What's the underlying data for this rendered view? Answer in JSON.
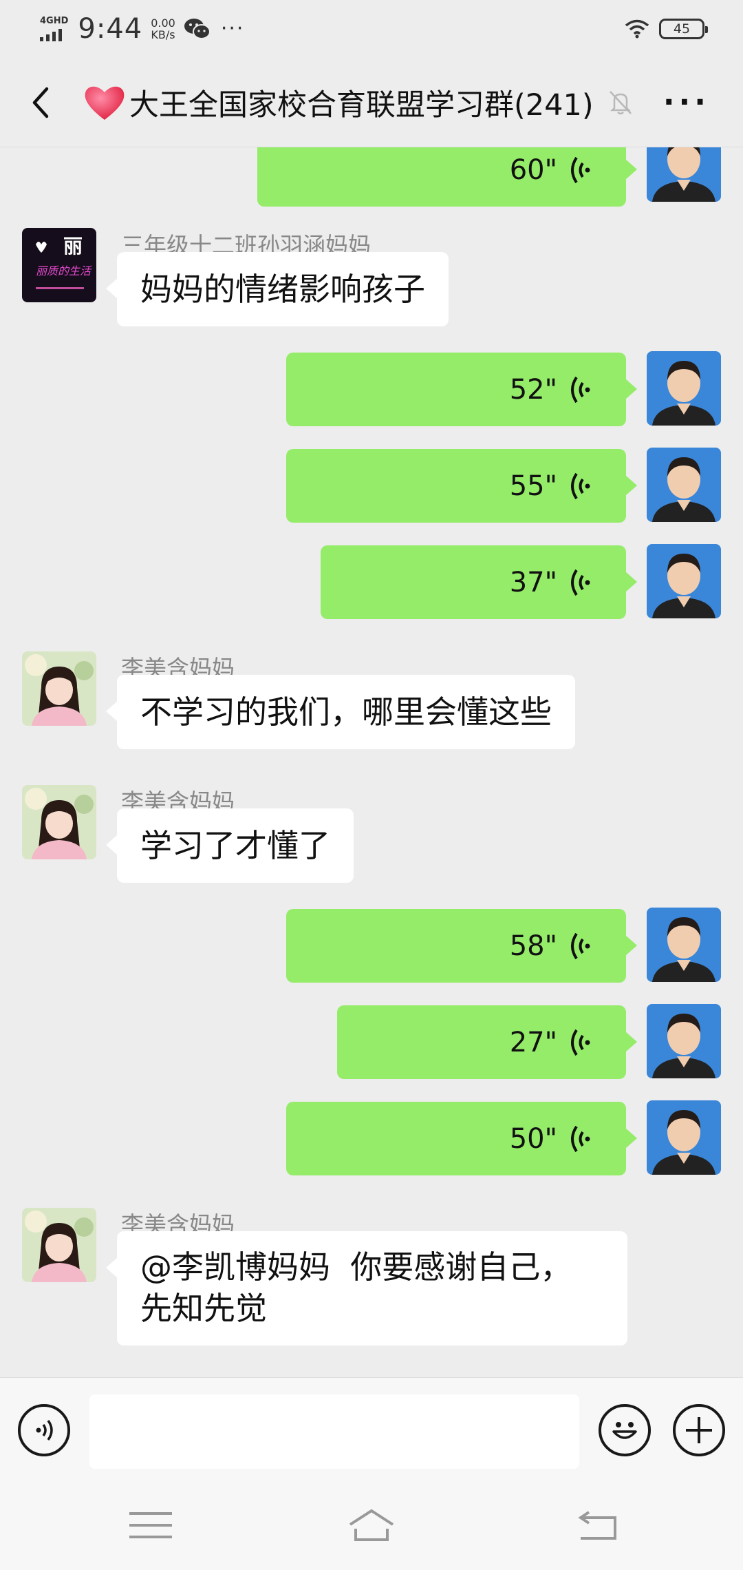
{
  "status_bar": {
    "network": "4GHD",
    "time": "9:44",
    "speed_value": "0.00",
    "speed_unit": "KB/s",
    "more": "···",
    "battery": "45"
  },
  "header": {
    "title": "大王全国家校合育联盟学习群(241)",
    "icons": [
      "back-icon",
      "heart-icon",
      "mute-bell-icon",
      "more-icon"
    ]
  },
  "messages": [
    {
      "type": "voice",
      "from": "me",
      "duration": "60\""
    },
    {
      "type": "text",
      "from": "三年级十二班孙羽涵妈妈",
      "text": "妈妈的情绪影响孩子"
    },
    {
      "type": "voice",
      "from": "me",
      "duration": "52\""
    },
    {
      "type": "voice",
      "from": "me",
      "duration": "55\""
    },
    {
      "type": "voice",
      "from": "me",
      "duration": "37\""
    },
    {
      "type": "text",
      "from": "李美含妈妈",
      "text": "不学习的我们，哪里会懂这些"
    },
    {
      "type": "text",
      "from": "李美含妈妈",
      "text": "学习了才懂了"
    },
    {
      "type": "voice",
      "from": "me",
      "duration": "58\""
    },
    {
      "type": "voice",
      "from": "me",
      "duration": "27\""
    },
    {
      "type": "voice",
      "from": "me",
      "duration": "50\""
    },
    {
      "type": "text",
      "from": "李美含妈妈",
      "text_line1": "@李凯博妈妈  你要感谢自己，",
      "text_line2": "先知先觉"
    }
  ],
  "avatar_badge": {
    "glyph": "丽",
    "caption": "丽质的生活"
  },
  "input_bar": {
    "placeholder": "",
    "icons": [
      "voice-input-icon",
      "emoji-icon",
      "plus-icon"
    ]
  },
  "nav_bar": {
    "icons": [
      "menu-icon",
      "home-icon",
      "back-nav-icon"
    ]
  },
  "colors": {
    "background": "#ededed",
    "my_bubble": "#95ec69",
    "other_bubble": "#ffffff",
    "sender_name": "#888888"
  }
}
